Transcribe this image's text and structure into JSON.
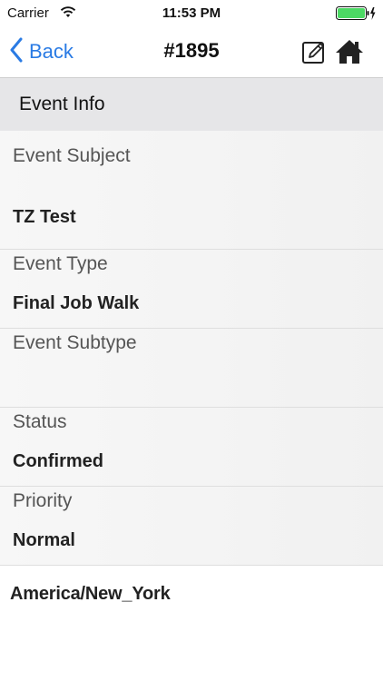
{
  "status_bar": {
    "carrier": "Carrier",
    "time": "11:53 PM",
    "wifi_icon": "wifi-icon",
    "battery_icon": "battery-charging-icon",
    "battery_color": "#4cd964"
  },
  "nav": {
    "back_label": "Back",
    "title": "#1895",
    "edit_icon": "edit-icon",
    "home_icon": "home-icon",
    "accent_color": "#2a7be4"
  },
  "section": {
    "title": "Event Info"
  },
  "fields": [
    {
      "label": "Event Subject",
      "value": "TZ Test"
    },
    {
      "label": "Event Type",
      "value": "Final Job Walk"
    },
    {
      "label": "Event Subtype",
      "value": ""
    },
    {
      "label": "Status",
      "value": "Confirmed"
    },
    {
      "label": "Priority",
      "value": "Normal"
    }
  ],
  "timezone": "America/New_York"
}
